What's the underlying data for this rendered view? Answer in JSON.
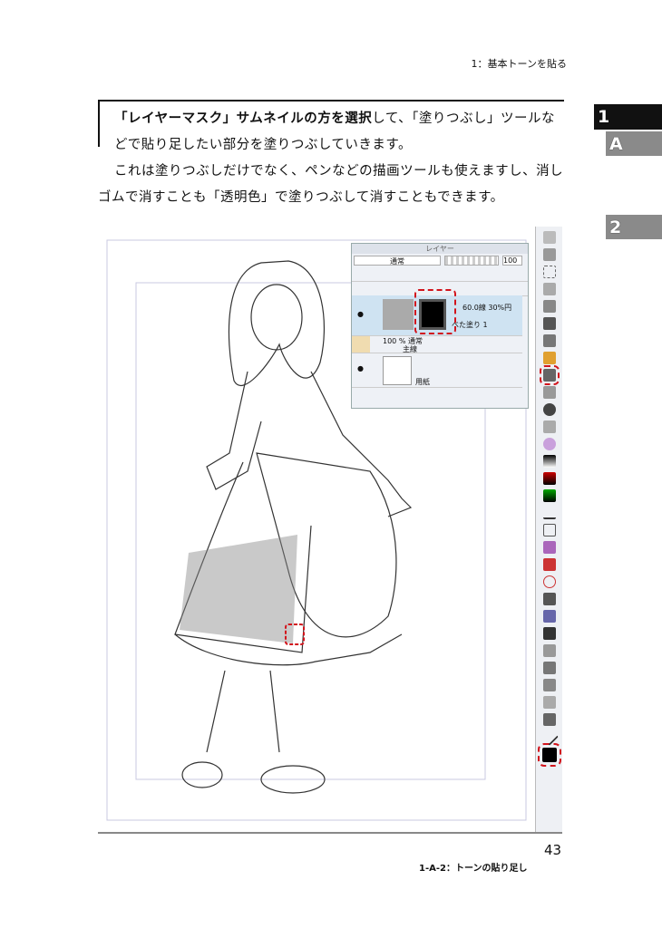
{
  "header": {
    "running_title": "1：基本トーンを貼る"
  },
  "side_tabs": {
    "chapter": "1",
    "section": "A",
    "next_chapter": "2"
  },
  "body": {
    "para1_bold": "「レイヤーマスク」サムネイルの方を選択",
    "para1_rest": "して、「塗りつぶし」ツールなどで貼り足したい部分を塗りつぶしていきます。",
    "para2": "これは塗りつぶしだけでなく、ペンなどの描画ツールも使えますし、消しゴムで消すことも「透明色」で塗りつぶして消すこともできます。"
  },
  "layer_panel": {
    "title": "レイヤー",
    "blend_mode": "通常",
    "opacity": "100",
    "layers": [
      {
        "info": "60.0線 30%円",
        "name": "べた塗り 1"
      },
      {
        "info": "100 % 通常",
        "name": "主線"
      },
      {
        "name": "用紙"
      }
    ]
  },
  "footer": {
    "page_number": "43",
    "caption": "1-A-2：トーンの貼り足し"
  },
  "colors": {
    "highlight": "#d2141c",
    "tab_dark": "#111111",
    "tab_gray": "#8a8a8a"
  }
}
